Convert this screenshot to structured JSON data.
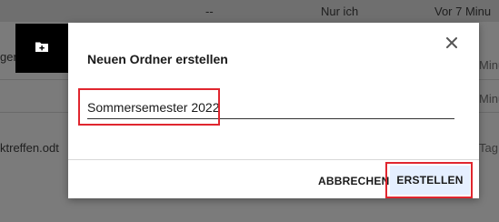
{
  "background": {
    "rows": [
      {
        "col_a": "--",
        "col_b": "Nur ich",
        "col_c": "Vor 7 Minu"
      },
      {
        "name": "gen",
        "col_c": "Minu"
      },
      {
        "col_c": "Minu"
      },
      {
        "name": "ktreffen.odt",
        "col_c": "Tag"
      }
    ]
  },
  "dialog": {
    "title": "Neuen Ordner erstellen",
    "icon": "new-folder-icon",
    "close_icon": "close-icon",
    "folder_name_value": "Sommersemester 2022",
    "cancel_label": "ABBRECHEN",
    "create_label": "ERSTELLEN"
  },
  "colors": {
    "highlight": "#e0262f",
    "create_button_bg": "#e5efff",
    "badge_bg": "#000000"
  }
}
